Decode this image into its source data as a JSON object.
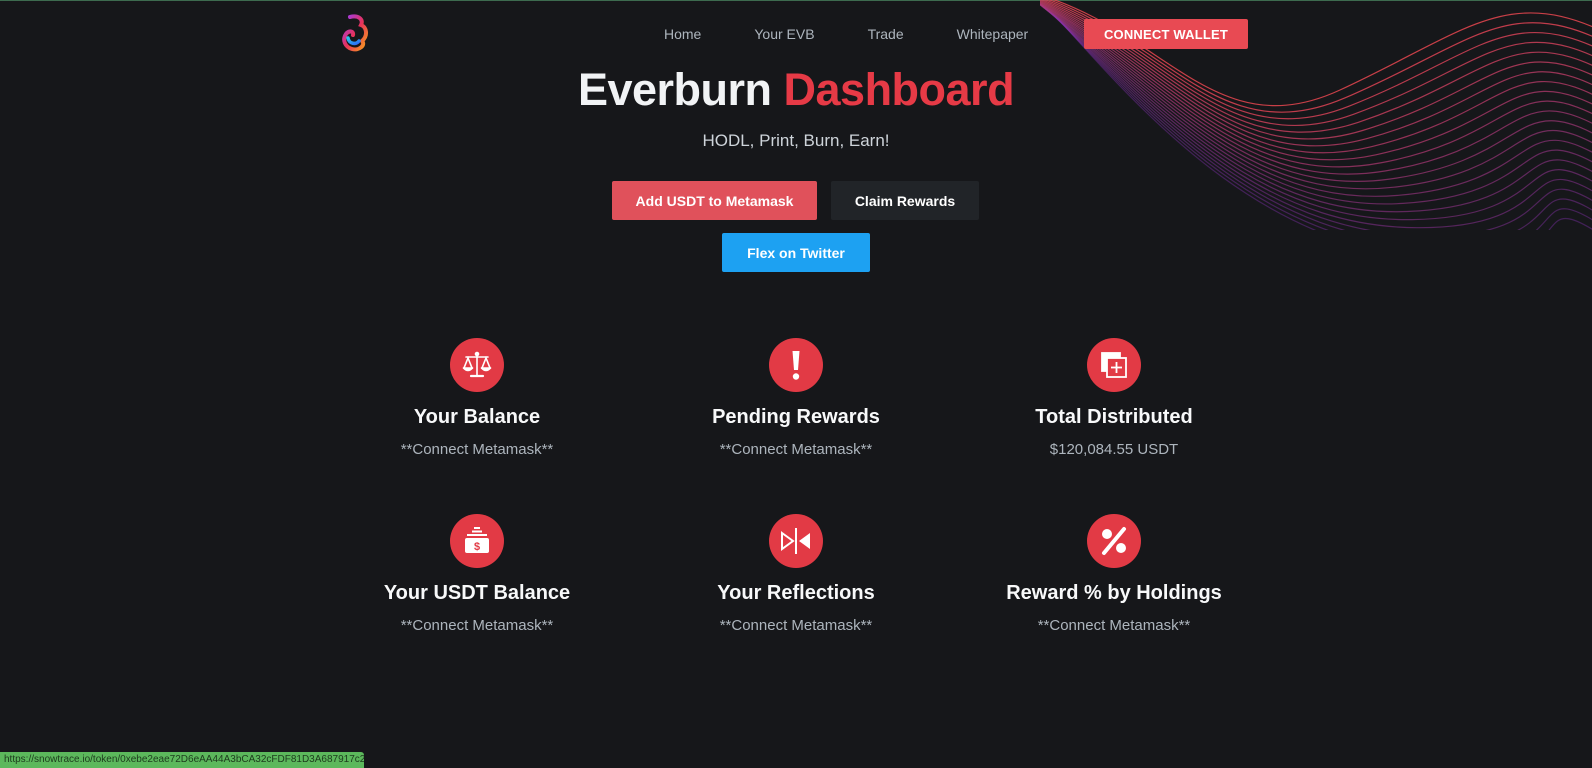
{
  "nav": {
    "items": [
      {
        "label": "Home"
      },
      {
        "label": "Your EVB"
      },
      {
        "label": "Trade"
      },
      {
        "label": "Whitepaper"
      }
    ],
    "connect_label": "CONNECT WALLET"
  },
  "hero": {
    "title_main": "Everburn",
    "title_accent": "Dashboard",
    "subtitle": "HODL, Print, Burn, Earn!"
  },
  "actions": {
    "add_usdt": "Add USDT to Metamask",
    "claim": "Claim Rewards",
    "flex": "Flex on Twitter"
  },
  "stats": [
    {
      "icon": "balance-scale-icon",
      "title": "Your Balance",
      "value": "**Connect Metamask**"
    },
    {
      "icon": "exclamation-icon",
      "title": "Pending Rewards",
      "value": "**Connect Metamask**"
    },
    {
      "icon": "add-copy-icon",
      "title": "Total Distributed",
      "value": "$120,084.55 USDT"
    },
    {
      "icon": "cash-register-icon",
      "title": "Your USDT Balance",
      "value": "**Connect Metamask**"
    },
    {
      "icon": "reflect-icon",
      "title": "Your Reflections",
      "value": "**Connect Metamask**"
    },
    {
      "icon": "percent-icon",
      "title": "Reward % by Holdings",
      "value": "**Connect Metamask**"
    }
  ],
  "status_bar": {
    "url": "https://snowtrace.io/token/0xebe2eae72D6eAA44A3bCA32cFDF81D3A687917c2"
  },
  "colors": {
    "background": "#16171a",
    "accent": "#e23a45",
    "twitter": "#1da1f2"
  }
}
